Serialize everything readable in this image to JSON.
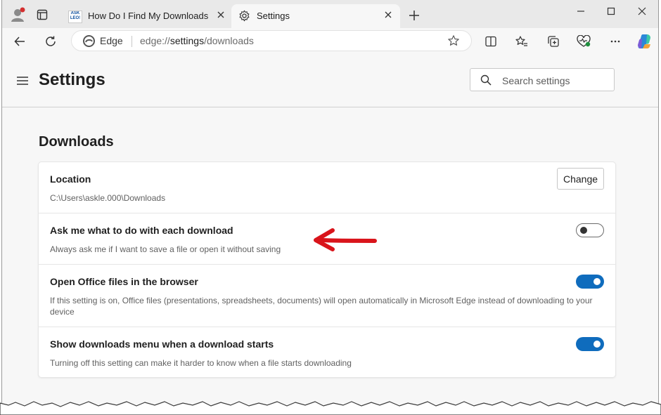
{
  "browser": {
    "tabs": [
      {
        "label": "How Do I Find My Downloads on",
        "active": false,
        "favicon": "askleo-favicon"
      },
      {
        "label": "Settings",
        "active": true,
        "favicon": "gear-icon"
      }
    ],
    "address": {
      "brand": "Edge",
      "url_prefix": "edge://",
      "url_main": "settings",
      "url_suffix": "/downloads"
    }
  },
  "settings": {
    "title": "Settings",
    "search_placeholder": "Search settings",
    "section_title": "Downloads",
    "rows": [
      {
        "title": "Location",
        "desc": "C:\\Users\\askle.000\\Downloads",
        "button": "Change"
      },
      {
        "title": "Ask me what to do with each download",
        "desc": "Always ask me if I want to save a file or open it without saving",
        "toggle": "off"
      },
      {
        "title": "Open Office files in the browser",
        "desc": "If this setting is on, Office files (presentations, spreadsheets, documents) will open automatically in Microsoft Edge instead of downloading to your device",
        "toggle": "on"
      },
      {
        "title": "Show downloads menu when a download starts",
        "desc": "Turning off this setting can make it harder to know when a file starts downloading",
        "toggle": "on"
      }
    ]
  },
  "colors": {
    "accent": "#0f6cbd",
    "arrow": "#d9141b"
  }
}
